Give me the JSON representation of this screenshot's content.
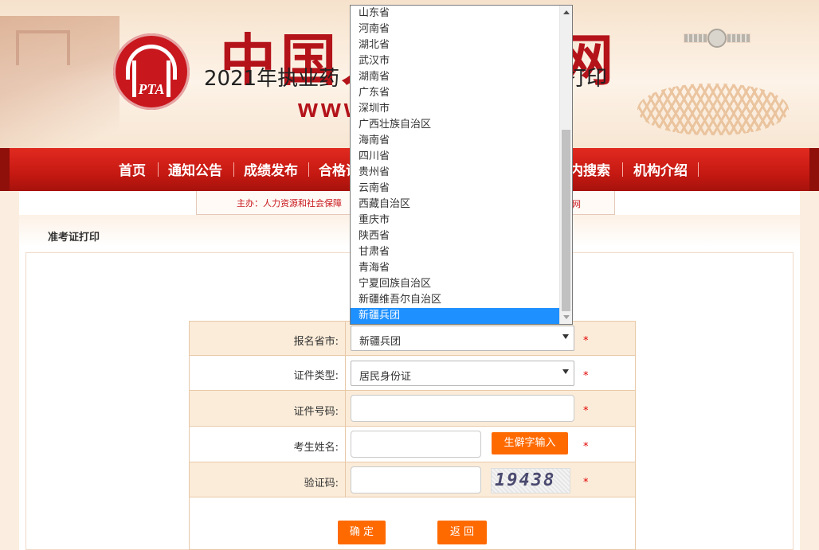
{
  "header": {
    "logo_text": "PTA",
    "title_part1": "中国人",
    "title_part2": "网",
    "url_part": "www"
  },
  "nav": {
    "items": [
      "首页",
      "通知公告",
      "成绩发布",
      "合格证",
      "内搜索",
      "机构介绍"
    ]
  },
  "subbar": {
    "sponsor_prefix": "主办：人力资源和社会保障",
    "sponsor_suffix": "网"
  },
  "breadcrumb": "准考证打印",
  "page_title_part1": "2021年执业药",
  "page_title_part2": "打印",
  "form": {
    "province": {
      "label": "报名省市:",
      "value": "新疆兵团"
    },
    "id_type": {
      "label": "证件类型:",
      "value": "居民身份证"
    },
    "id_number": {
      "label": "证件号码:",
      "value": ""
    },
    "name": {
      "label": "考生姓名:",
      "value": "",
      "rare_char_button": "生僻字输入"
    },
    "captcha": {
      "label": "验证码:",
      "value": "",
      "image_text": "19438"
    },
    "required_mark": "*",
    "confirm_button": "确 定",
    "back_button": "返 回"
  },
  "dropdown": {
    "options": [
      "山东省",
      "河南省",
      "湖北省",
      "武汉市",
      "湖南省",
      "广东省",
      "深圳市",
      "广西壮族自治区",
      "海南省",
      "四川省",
      "贵州省",
      "云南省",
      "西藏自治区",
      "重庆市",
      "陕西省",
      "甘肃省",
      "青海省",
      "宁夏回族自治区",
      "新疆维吾尔自治区",
      "新疆兵团"
    ],
    "selected": "新疆兵团"
  },
  "colors": {
    "nav_red": "#c51912",
    "brand_red": "#b4131a",
    "action_orange": "#ff6a00",
    "selection_blue": "#1e90ff"
  }
}
